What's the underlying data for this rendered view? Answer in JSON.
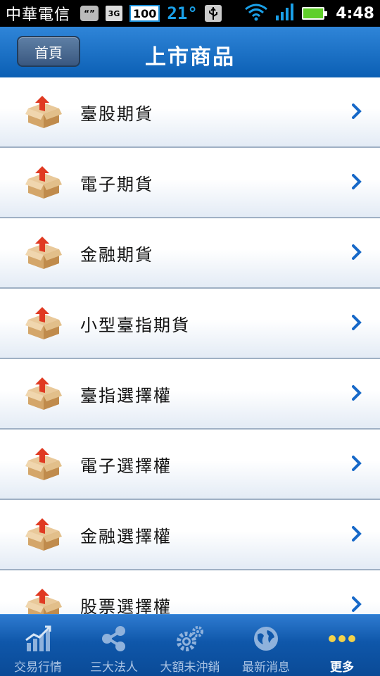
{
  "status_bar": {
    "carrier": "中華電信",
    "icons": {
      "message": "“”",
      "network": "3G",
      "battery_badge": "100",
      "temperature": "21°",
      "usb": "usb-icon"
    },
    "time": "4:48",
    "colors": {
      "battery": "#5fcf2a",
      "wifi": "#1aa0e8",
      "signal": "#1aa0e8"
    }
  },
  "header": {
    "home_label": "首頁",
    "title": "上市商品",
    "accent": "#0b5fb4"
  },
  "list": {
    "icon": "product-box-icon",
    "items": [
      {
        "label": "臺股期貨"
      },
      {
        "label": "電子期貨"
      },
      {
        "label": "金融期貨"
      },
      {
        "label": "小型臺指期貨"
      },
      {
        "label": "臺指選擇權"
      },
      {
        "label": "電子選擇權"
      },
      {
        "label": "金融選擇權"
      },
      {
        "label": "股票選擇權"
      }
    ]
  },
  "tabs": [
    {
      "label": "交易行情",
      "icon": "chart-icon",
      "active": false
    },
    {
      "label": "三大法人",
      "icon": "share-nodes-icon",
      "active": false
    },
    {
      "label": "大額未沖銷",
      "icon": "gears-icon",
      "active": false
    },
    {
      "label": "最新消息",
      "icon": "globe-icon",
      "active": false
    },
    {
      "label": "更多",
      "icon": "more-dots-icon",
      "active": true
    }
  ]
}
